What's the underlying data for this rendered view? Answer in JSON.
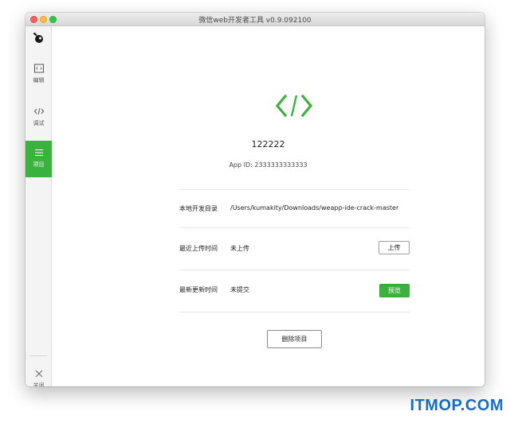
{
  "window": {
    "title": "微信web开发者工具 v0.9.092100"
  },
  "sidebar": {
    "logo_icon": "wechat-devtools-logo-icon",
    "items": [
      {
        "label": "编辑",
        "icon": "editor-icon",
        "active": false
      },
      {
        "label": "调试",
        "icon": "code-debug-icon",
        "active": false
      },
      {
        "label": "项目",
        "icon": "menu-list-icon",
        "active": true
      }
    ],
    "close": {
      "label": "关闭",
      "icon": "close-icon"
    }
  },
  "project": {
    "icon": "code-brackets-icon",
    "name": "122222",
    "app_id": "App ID: 2333333333333",
    "rows": [
      {
        "label": "本地开发目录",
        "value": "/Users/kumakity/Downloads/weapp-ide-crack-master"
      },
      {
        "label": "最近上传时间",
        "value": "未上传",
        "button": "上传"
      },
      {
        "label": "最新更新时间",
        "value": "未提交",
        "button": "预览"
      }
    ],
    "delete_button": "删除项目"
  },
  "watermark": "ITMOP.COM",
  "colors": {
    "accent_green": "#3bb23d",
    "watermark_blue": "#1b6bc2"
  }
}
